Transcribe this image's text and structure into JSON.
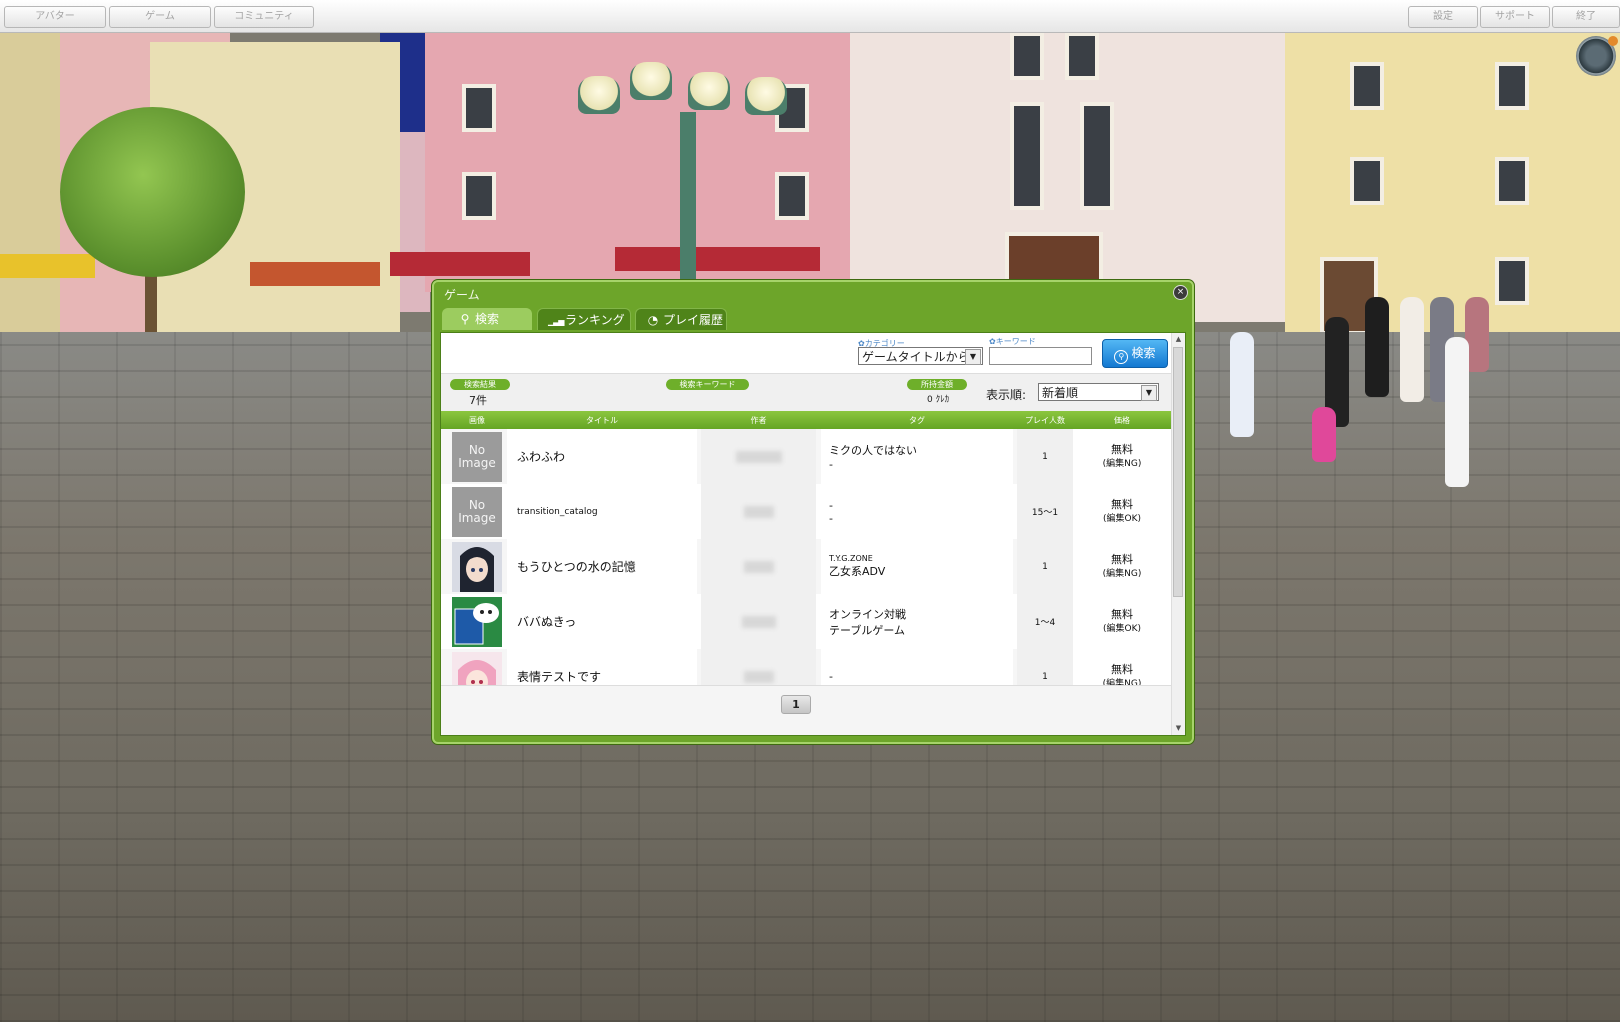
{
  "topbar": {
    "left_buttons": [
      "アバター",
      "ゲーム",
      "コミュニティ"
    ],
    "right_buttons": [
      "設定",
      "サポート",
      "終了"
    ]
  },
  "window": {
    "title": "ゲーム",
    "close_glyph": "×",
    "tabs": [
      {
        "label": "検索",
        "icon": "search-icon",
        "glyph": "⚲"
      },
      {
        "label": "ランキング",
        "icon": "bar-chart-icon",
        "glyph": "▁▃▅"
      },
      {
        "label": "プレイ履歴",
        "icon": "clock-icon",
        "glyph": "◔"
      }
    ],
    "active_tab": 0
  },
  "filters": {
    "category_label": "カテゴリー",
    "category_value": "ゲームタイトルから",
    "keyword_label": "キーワード",
    "keyword_value": "",
    "search_button": "検索",
    "arrow": "▼"
  },
  "info": {
    "result_label": "検索結果",
    "result_value": "7件",
    "keyword_label": "検索キーワード",
    "keyword_value": "",
    "balance_label": "所持金額",
    "balance_value": "0 ｸﾚｶ",
    "sort_label": "表示順:",
    "sort_value": "新着順"
  },
  "table": {
    "headers": [
      "画像",
      "タイトル",
      "作者",
      "タグ",
      "プレイ人数",
      "価格"
    ],
    "rows": [
      {
        "image": "No Image",
        "title": "ふわふわ",
        "tag1": "ミクの人ではない",
        "tag2": "-",
        "players": "1",
        "price": "無料",
        "edit": "(編集NG)"
      },
      {
        "image": "No Image",
        "title": "transition_catalog",
        "tag1": "-",
        "tag2": "-",
        "players": "15〜1",
        "price": "無料",
        "edit": "(編集OK)"
      },
      {
        "image": "anime-girl-thumbnail",
        "title": "もうひとつの水の記憶",
        "tag1": "T.Y.G.ZONE",
        "tag2": "乙女系ADV",
        "players": "1",
        "price": "無料",
        "edit": "(編集NG)"
      },
      {
        "image": "card-game-thumbnail",
        "title": "ババぬきっ",
        "tag1": "オンライン対戦",
        "tag2": "テーブルゲーム",
        "players": "1〜4",
        "price": "無料",
        "edit": "(編集OK)"
      },
      {
        "image": "pink-hair-thumbnail",
        "title": "表情テストです",
        "tag1": "-",
        "tag2": "",
        "players": "1",
        "price": "無料",
        "edit": "(編集NG)"
      }
    ]
  },
  "pager": {
    "current_page": "1"
  },
  "scrollbar": {
    "up": "▲",
    "down": "▼"
  }
}
